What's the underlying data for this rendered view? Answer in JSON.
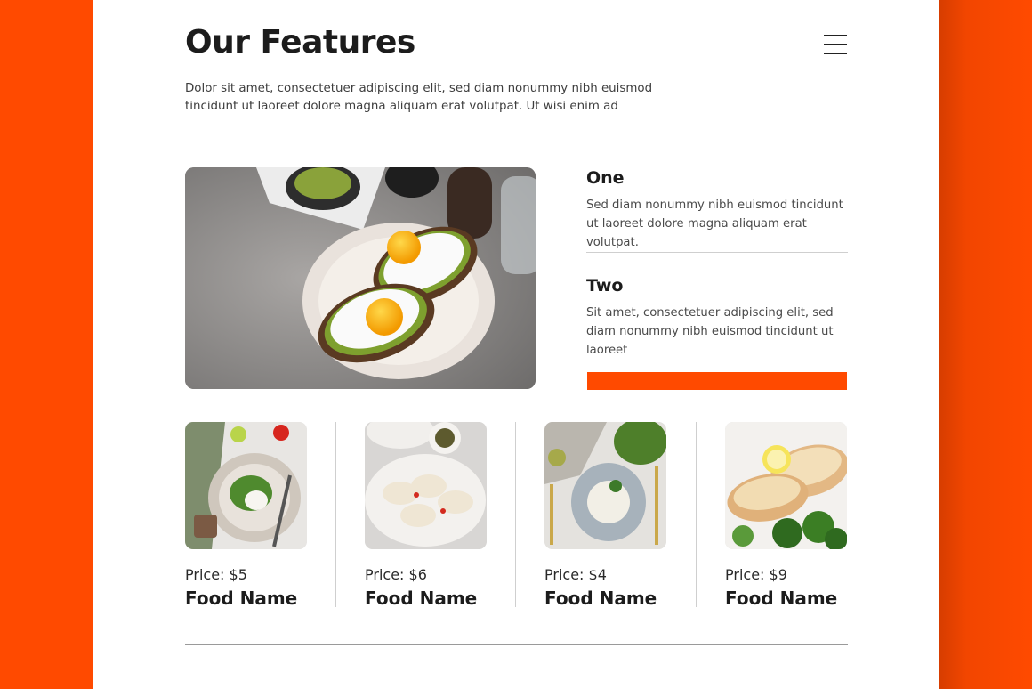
{
  "colors": {
    "accent": "#ff4a00",
    "text": "#1c1c1c",
    "muted": "#4a4a4a"
  },
  "header": {
    "title": "Our Features",
    "menu_icon": "hamburger-menu-icon",
    "intro": "Dolor sit amet, consectetuer adipiscing elit, sed diam nonummy nibh euismod tincidunt ut laoreet dolore magna aliquam erat volutpat. Ut wisi enim ad"
  },
  "features": [
    {
      "title": "One",
      "text": "Sed diam nonummy nibh euismod tincidunt ut laoreet dolore magna aliquam erat volutpat."
    },
    {
      "title": "Two",
      "text": "Sit amet, consectetuer adipiscing elit, sed diam nonummy nibh euismod tincidunt ut laoreet"
    }
  ],
  "foods": [
    {
      "price": "Price: $5",
      "name": "Food Name"
    },
    {
      "price": "Price: $6",
      "name": "Food Name"
    },
    {
      "price": "Price: $4",
      "name": "Food Name"
    },
    {
      "price": "Price: $9",
      "name": "Food Name"
    }
  ]
}
